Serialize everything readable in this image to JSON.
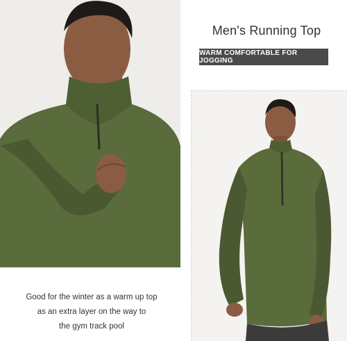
{
  "product": {
    "title": "Men's Running Top",
    "tagline": "WARM COMFORTABLE FOR JOGGING",
    "caption_lines": [
      "Good for the winter as a warm up top",
      "as an extra layer on the way to",
      "the gym track pool"
    ],
    "shirt_color": "#5a6b3c",
    "shirt_shadow": "#4a5931",
    "skin_color": "#8a5d43",
    "hair_color": "#1f1a17",
    "jeans_color": "#3d3b3a",
    "zipper_color": "#2b2f25"
  }
}
